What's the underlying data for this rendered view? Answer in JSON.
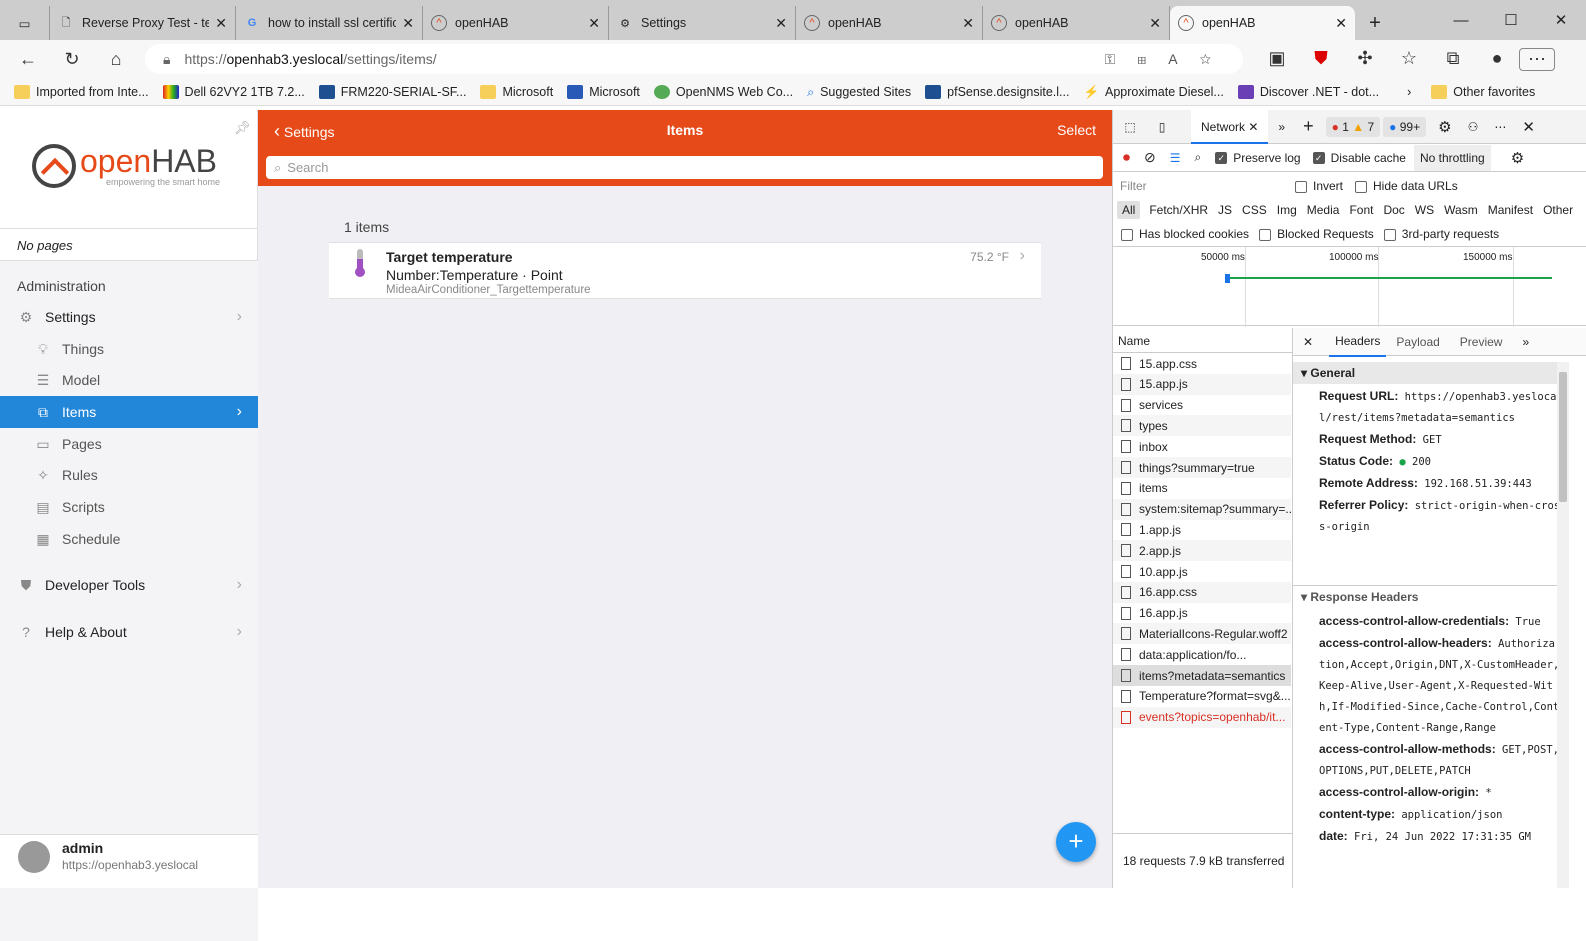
{
  "browser": {
    "tabs": [
      {
        "title": "Reverse Proxy Test - tes",
        "icon": "document-icon"
      },
      {
        "title": "how to install ssl certific",
        "icon": "google-icon"
      },
      {
        "title": "openHAB",
        "icon": "openhab-icon"
      },
      {
        "title": "Settings",
        "icon": "gear-icon"
      },
      {
        "title": "openHAB",
        "icon": "openhab-icon"
      },
      {
        "title": "openHAB",
        "icon": "openhab-icon"
      },
      {
        "title": "openHAB",
        "icon": "openhab-icon",
        "active": true
      }
    ],
    "url_scheme": "https://",
    "url_host": "openhab3.yeslocal",
    "url_path": "/settings/items/",
    "bookmarks": [
      "Imported from Inte...",
      "Dell 62VY2 1TB 7.2...",
      "FRM220-SERIAL-SF...",
      "Microsoft",
      "Microsoft",
      "OpenNMS Web Co...",
      "Suggested Sites",
      "pfSense.designsite.l...",
      "Approximate Diesel...",
      "Discover .NET - dot..."
    ],
    "other_favorites": "Other favorites"
  },
  "sidebar": {
    "no_pages": "No pages",
    "administration": "Administration",
    "settings": "Settings",
    "sub": [
      "Things",
      "Model",
      "Items",
      "Pages",
      "Rules",
      "Scripts",
      "Schedule"
    ],
    "developer_tools": "Developer Tools",
    "help": "Help & About",
    "user": "admin",
    "user_url": "https://openhab3.yeslocal",
    "logo_text": "openHAB",
    "logo_tagline": "empowering the smart home"
  },
  "main": {
    "back": "Settings",
    "title": "Items",
    "select": "Select",
    "search_placeholder": "Search",
    "count": "1 items",
    "items": [
      {
        "label": "Target temperature",
        "type": "Number:Temperature · Point",
        "name": "MideaAirConditioner_Targettemperature",
        "state": "75.2 °F"
      }
    ],
    "accent": "#e64a19"
  },
  "devtools": {
    "tab": "Network",
    "errors": "1",
    "warnings": "7",
    "messages": "99+",
    "preserve_log": "Preserve log",
    "disable_cache": "Disable cache",
    "throttling": "No throttling",
    "filter_placeholder": "Filter",
    "invert": "Invert",
    "hide_data_urls": "Hide data URLs",
    "types": [
      "All",
      "Fetch/XHR",
      "JS",
      "CSS",
      "Img",
      "Media",
      "Font",
      "Doc",
      "WS",
      "Wasm",
      "Manifest",
      "Other"
    ],
    "has_blocked_cookies": "Has blocked cookies",
    "blocked_requests": "Blocked Requests",
    "third_party": "3rd-party requests",
    "timeline_ticks": [
      "50000 ms",
      "100000 ms",
      "150000 ms"
    ],
    "name_header": "Name",
    "requests": [
      "15.app.css",
      "15.app.js",
      "services",
      "types",
      "inbox",
      "things?summary=true",
      "items",
      "system:sitemap?summary=...",
      "1.app.js",
      "2.app.js",
      "10.app.js",
      "16.app.css",
      "16.app.js",
      "MaterialIcons-Regular.woff2",
      "data:application/fo...",
      "items?metadata=semantics",
      "Temperature?format=svg&...",
      "events?topics=openhab/it..."
    ],
    "summary": "18 requests  7.9 kB transferred",
    "detail_tabs": [
      "Headers",
      "Payload",
      "Preview"
    ],
    "general_title": "General",
    "general": [
      {
        "k": "Request URL:",
        "v": "https://openhab3.yeslocal/rest/items?metadata=semantics"
      },
      {
        "k": "Request Method:",
        "v": "GET"
      },
      {
        "k": "Status Code:",
        "v": "200"
      },
      {
        "k": "Remote Address:",
        "v": "192.168.51.39:443"
      },
      {
        "k": "Referrer Policy:",
        "v": "strict-origin-when-cross-origin"
      }
    ],
    "response_title": "Response Headers",
    "response": [
      {
        "k": "access-control-allow-credentials:",
        "v": "True"
      },
      {
        "k": "access-control-allow-headers:",
        "v": "Authorization,Accept,Origin,DNT,X-CustomHeader,Keep-Alive,User-Agent,X-Requested-With,If-Modified-Since,Cache-Control,Content-Type,Content-Range,Range"
      },
      {
        "k": "access-control-allow-methods:",
        "v": "GET,POST,OPTIONS,PUT,DELETE,PATCH"
      },
      {
        "k": "access-control-allow-origin:",
        "v": "*"
      },
      {
        "k": "content-type:",
        "v": "application/json"
      },
      {
        "k": "date:",
        "v": "Fri, 24 Jun 2022 17:31:35 GM"
      }
    ]
  }
}
